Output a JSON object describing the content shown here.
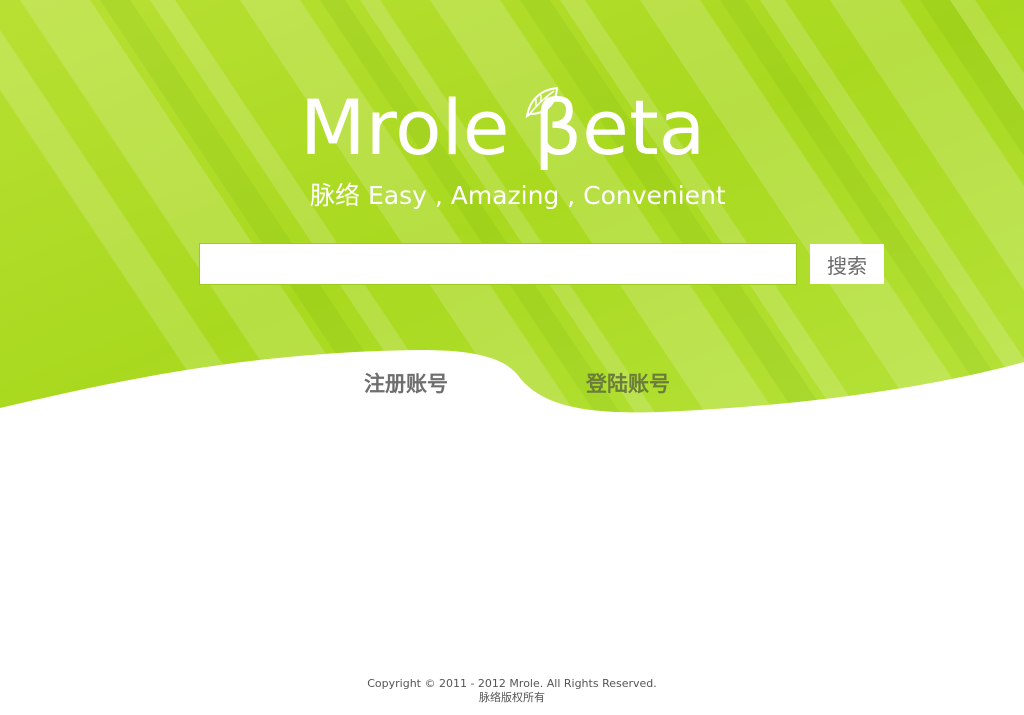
{
  "colors": {
    "primary_green": "#a6d81d",
    "light_green": "#c4ea4a",
    "white": "#ffffff",
    "text_gray": "#6e6e6e"
  },
  "logo": {
    "text": "Mrole βeta",
    "icon": "leaf-icon"
  },
  "tagline": "脉络 Easy , Amazing , Convenient",
  "search": {
    "value": "",
    "placeholder": "",
    "button_label": "搜索"
  },
  "nav": {
    "register_label": "注册账号",
    "login_label": "登陆账号"
  },
  "footer": {
    "copyright": "Copyright © 2011 - 2012 Mrole. All Rights Reserved.",
    "rights": "脉络版权所有"
  }
}
